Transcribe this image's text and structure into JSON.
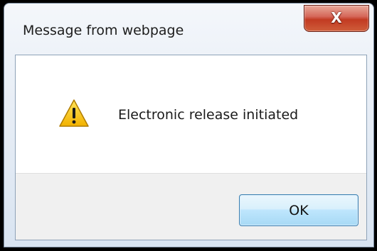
{
  "dialog": {
    "title": "Message from webpage",
    "message": "Electronic release initiated",
    "ok_label": "OK"
  },
  "icons": {
    "close": "close-icon",
    "warning": "warning-icon"
  },
  "colors": {
    "close_button": "#c94a30",
    "ok_border": "#3c7fb1",
    "warning_fill": "#f5c400",
    "button_strip": "#f0f0f0"
  }
}
